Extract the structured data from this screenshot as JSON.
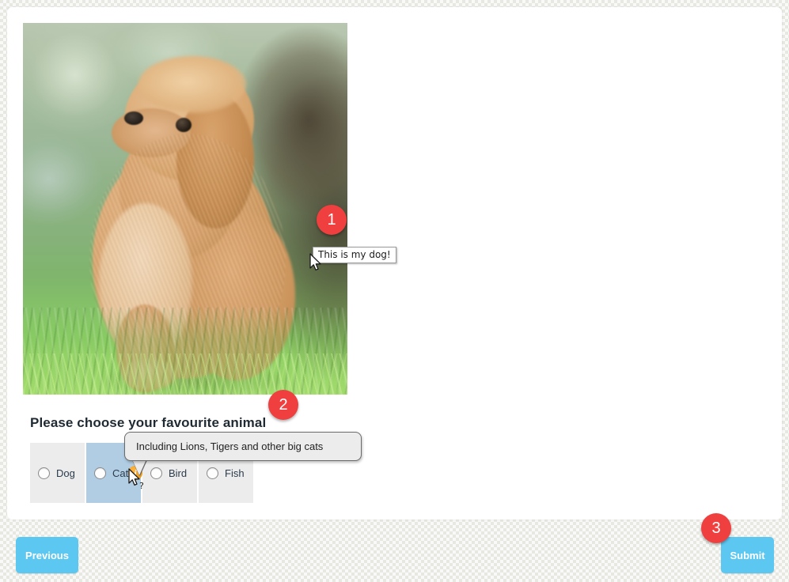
{
  "panel": {
    "photo": {
      "alt_title": "This is my dog!",
      "tooltip_text": "This is my dog!"
    },
    "question": {
      "title": "Please choose your favourite animal",
      "options": [
        {
          "label": "Dog",
          "selected": false,
          "hovered": false,
          "has_info": false
        },
        {
          "label": "Cat",
          "selected": false,
          "hovered": true,
          "has_info": true
        },
        {
          "label": "Bird",
          "selected": false,
          "hovered": false,
          "has_info": false
        },
        {
          "label": "Fish",
          "selected": false,
          "hovered": false,
          "has_info": false
        }
      ],
      "info_tooltip": "Including Lions, Tigers and other big cats",
      "info_icon_glyph": "i"
    }
  },
  "footer": {
    "previous_label": "Previous",
    "submit_label": "Submit"
  },
  "annotations": [
    {
      "number": "1"
    },
    {
      "number": "2"
    },
    {
      "number": "3"
    }
  ],
  "colors": {
    "button_blue": "#5cc8f2",
    "badge_red": "#f03f3f",
    "option_bg": "#ececec",
    "option_hover_bg": "#b1cde4",
    "info_orange": "#f5a01b",
    "page_bg": "#e8e8e2"
  }
}
